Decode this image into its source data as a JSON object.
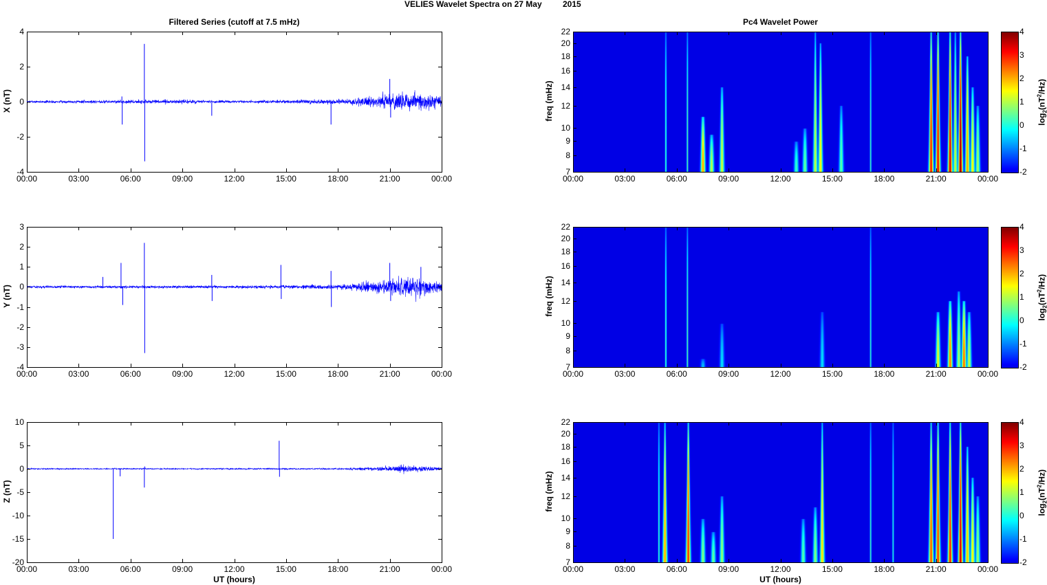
{
  "title_main": "VELIES Wavelet Spectra on 27 May",
  "title_year": "2015",
  "left_title": "Filtered Series (cutoff at 7.5 mHz)",
  "right_title": "Pc4 Wavelet Power",
  "xlabel": "UT (hours)",
  "time_ticks": [
    "00:00",
    "03:00",
    "06:00",
    "09:00",
    "12:00",
    "15:00",
    "18:00",
    "21:00",
    "00:00"
  ],
  "freq_label": "freq (mHz)",
  "colorbar_label": {
    "a": "log",
    "b": "2",
    "c": "(nT",
    "d": "2",
    "e": "/Hz)"
  },
  "colors": {
    "series": "#0000ff"
  },
  "chart_data": [
    {
      "type": "line",
      "ylabel": "X (nT)",
      "ylim": [
        -4,
        4
      ],
      "yticks": [
        "-4",
        "-2",
        "0",
        "2",
        "4"
      ],
      "xlim": [
        0,
        24
      ],
      "noise_envelope": [
        [
          0,
          0.06
        ],
        [
          7,
          0.1
        ],
        [
          8,
          0.12
        ],
        [
          12,
          0.06
        ],
        [
          18,
          0.12
        ],
        [
          20,
          0.25
        ],
        [
          21,
          0.45
        ],
        [
          22,
          0.55
        ],
        [
          23.2,
          0.4
        ],
        [
          24,
          0.3
        ]
      ],
      "spikes": [
        [
          5.5,
          0.3
        ],
        [
          5.52,
          -1.3
        ],
        [
          6.8,
          3.3
        ],
        [
          6.82,
          -3.4
        ],
        [
          10.7,
          -0.8
        ],
        [
          17.6,
          -1.3
        ],
        [
          21.0,
          1.3
        ],
        [
          21.05,
          -0.9
        ]
      ]
    },
    {
      "type": "line",
      "ylabel": "Y (nT)",
      "ylim": [
        -4,
        3
      ],
      "yticks": [
        "-4",
        "-3",
        "-2",
        "-1",
        "0",
        "1",
        "2",
        "3"
      ],
      "xlim": [
        0,
        24
      ],
      "noise_envelope": [
        [
          0,
          0.06
        ],
        [
          12,
          0.06
        ],
        [
          18,
          0.12
        ],
        [
          20,
          0.25
        ],
        [
          21,
          0.4
        ],
        [
          22,
          0.5
        ],
        [
          23.2,
          0.35
        ],
        [
          24,
          0.25
        ]
      ],
      "spikes": [
        [
          4.4,
          0.5
        ],
        [
          5.45,
          1.2
        ],
        [
          5.55,
          -0.9
        ],
        [
          6.8,
          2.2
        ],
        [
          6.82,
          -3.3
        ],
        [
          10.7,
          0.6
        ],
        [
          10.72,
          -0.7
        ],
        [
          14.7,
          1.1
        ],
        [
          14.72,
          -0.6
        ],
        [
          17.6,
          0.8
        ],
        [
          17.62,
          -1.0
        ],
        [
          21.0,
          1.2
        ],
        [
          21.05,
          -0.7
        ],
        [
          22.8,
          1.0
        ]
      ]
    },
    {
      "type": "line",
      "ylabel": "Z (nT)",
      "ylim": [
        -20,
        10
      ],
      "yticks": [
        "-20",
        "-15",
        "-10",
        "-5",
        "0",
        "5",
        "10"
      ],
      "xlim": [
        0,
        24
      ],
      "noise_envelope": [
        [
          0,
          0.1
        ],
        [
          18,
          0.15
        ],
        [
          20,
          0.35
        ],
        [
          21,
          0.6
        ],
        [
          22,
          0.7
        ],
        [
          24,
          0.3
        ]
      ],
      "spikes": [
        [
          5.0,
          -15
        ],
        [
          5.4,
          -1.6
        ],
        [
          6.8,
          -4
        ],
        [
          6.82,
          0.5
        ],
        [
          14.6,
          6
        ],
        [
          14.62,
          -1.7
        ]
      ]
    },
    {
      "type": "heatmap",
      "title": "Pc4 Wavelet Power",
      "ylabel": "freq (mHz)",
      "ylim": [
        7,
        22
      ],
      "yticks": [
        "7",
        "8",
        "9",
        "10",
        "12",
        "14",
        "16",
        "18",
        "20",
        "22"
      ],
      "clim": [
        -2,
        4
      ],
      "cticks": [
        "-2",
        "-1",
        "0",
        "1",
        "2",
        "3",
        "4"
      ],
      "events_hour_power_topfreq": [
        [
          5.35,
          0.6,
          22
        ],
        [
          6.6,
          0.6,
          22
        ],
        [
          7.5,
          2.2,
          11
        ],
        [
          8.0,
          1.2,
          9.5
        ],
        [
          8.6,
          1.3,
          14
        ],
        [
          12.9,
          0.3,
          9
        ],
        [
          13.4,
          0.6,
          10
        ],
        [
          14.0,
          1.2,
          22
        ],
        [
          14.3,
          1.6,
          20
        ],
        [
          15.5,
          0.5,
          12
        ],
        [
          17.2,
          0.4,
          22
        ],
        [
          20.7,
          3.2,
          22
        ],
        [
          21.1,
          3.4,
          22
        ],
        [
          21.8,
          3.6,
          22
        ],
        [
          22.1,
          1.2,
          22
        ],
        [
          22.4,
          4,
          22
        ],
        [
          22.8,
          2.2,
          18
        ],
        [
          23.1,
          1.6,
          14
        ],
        [
          23.4,
          1.0,
          12
        ]
      ]
    },
    {
      "type": "heatmap",
      "ylabel": "freq (mHz)",
      "ylim": [
        7,
        22
      ],
      "yticks": [
        "7",
        "8",
        "9",
        "10",
        "12",
        "14",
        "16",
        "18",
        "20",
        "22"
      ],
      "clim": [
        -2,
        4
      ],
      "cticks": [
        "-2",
        "-1",
        "0",
        "1",
        "2",
        "3",
        "4"
      ],
      "events_hour_power_topfreq": [
        [
          5.35,
          0.6,
          22
        ],
        [
          6.6,
          0.6,
          22
        ],
        [
          7.5,
          -0.5,
          7.5
        ],
        [
          8.6,
          -0.3,
          10
        ],
        [
          14.4,
          -0.3,
          11
        ],
        [
          17.2,
          0.3,
          22
        ],
        [
          21.1,
          1.5,
          11
        ],
        [
          21.8,
          2.5,
          12
        ],
        [
          22.3,
          1.0,
          13
        ],
        [
          22.6,
          2.6,
          12
        ],
        [
          22.9,
          1.2,
          11
        ]
      ]
    },
    {
      "type": "heatmap",
      "ylabel": "freq (mHz)",
      "ylim": [
        7,
        22
      ],
      "yticks": [
        "7",
        "8",
        "9",
        "10",
        "12",
        "14",
        "16",
        "18",
        "20",
        "22"
      ],
      "clim": [
        -2,
        4
      ],
      "cticks": [
        "-2",
        "-1",
        "0",
        "1",
        "2",
        "3",
        "4"
      ],
      "events_hour_power_topfreq": [
        [
          4.95,
          0.5,
          22
        ],
        [
          5.3,
          2.2,
          22
        ],
        [
          6.65,
          3.0,
          22
        ],
        [
          7.5,
          0.8,
          10
        ],
        [
          8.1,
          0.6,
          9
        ],
        [
          8.6,
          0.9,
          12
        ],
        [
          13.3,
          0.5,
          10
        ],
        [
          14.0,
          0.8,
          11
        ],
        [
          14.4,
          1.8,
          22
        ],
        [
          17.2,
          0.4,
          22
        ],
        [
          18.5,
          0.2,
          22
        ],
        [
          20.7,
          2.8,
          22
        ],
        [
          21.1,
          3.0,
          22
        ],
        [
          21.8,
          3.2,
          22
        ],
        [
          22.4,
          3.6,
          22
        ],
        [
          22.8,
          2.0,
          18
        ],
        [
          23.1,
          1.6,
          14
        ],
        [
          23.4,
          0.9,
          12
        ]
      ]
    }
  ]
}
